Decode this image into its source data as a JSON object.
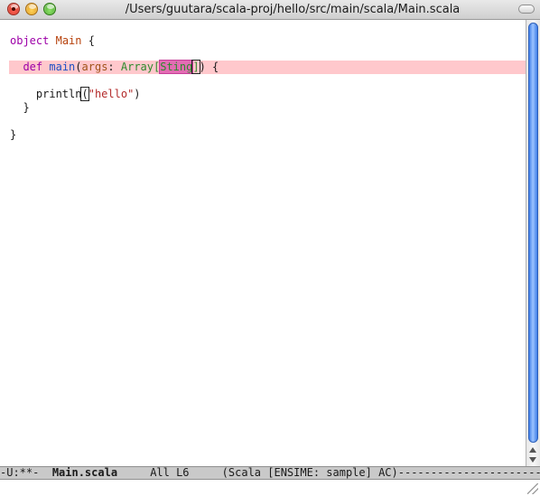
{
  "window": {
    "title": "/Users/guutara/scala-proj/hello/src/main/scala/Main.scala"
  },
  "code": {
    "line1": {
      "kw": "object",
      "name": "Main",
      "brace": " {"
    },
    "line2": {
      "kw": "def",
      "fn": "main",
      "open": "(",
      "param": "args",
      "colon": ": ",
      "type": "Array",
      "lbracket": "[",
      "err_type": "Sting",
      "rbracket": "]",
      "close": ") {"
    },
    "line3": {
      "fn": "println",
      "open": "(",
      "str": "\"hello\"",
      "close": ")"
    },
    "line4": {
      "brace": "}"
    },
    "line5": {
      "brace": "}"
    }
  },
  "modeline": {
    "status": "-U:**-",
    "buffer": "Main.scala",
    "position": "All L6",
    "modes": "(Scala [ENSIME: sample] AC)",
    "fill": "------------------------------------------------"
  },
  "colors": {
    "keyword": "#9d00a8",
    "object_name": "#b6400a",
    "error_line_bg": "#ffc8cc",
    "error_highlight": "#e36cb3",
    "scroll_thumb": "#3f7ee8"
  },
  "icons": {
    "close": "close-button-icon",
    "minimize": "minimize-button-icon",
    "zoom": "zoom-button-icon",
    "resize": "resize-grip-icon"
  }
}
